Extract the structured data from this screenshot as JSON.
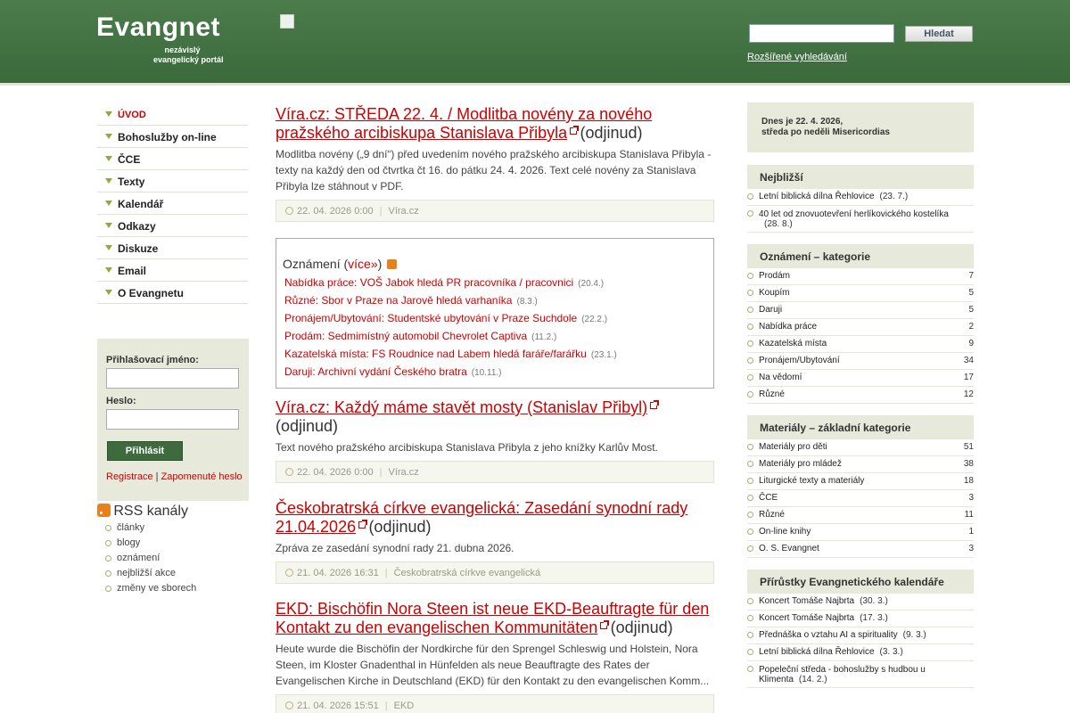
{
  "header": {
    "logo_title": "Evangnet",
    "logo_sub1": "nezávislý",
    "logo_sub2": "evangelický portál",
    "search_button": "Hledat",
    "advanced_search": "Rozšířené vyhledávání"
  },
  "nav": [
    {
      "label": "ÚVOD",
      "active": true
    },
    {
      "label": "Bohoslužby on-line"
    },
    {
      "label": "ČCE"
    },
    {
      "label": "Texty"
    },
    {
      "label": "Kalendář"
    },
    {
      "label": "Odkazy"
    },
    {
      "label": "Diskuze"
    },
    {
      "label": "Email"
    },
    {
      "label": "O Evangnetu"
    }
  ],
  "login": {
    "username_label": "Přihlašovací jméno:",
    "password_label": "Heslo:",
    "button": "Přihlásit",
    "register": "Registrace",
    "separator": "|",
    "forgot": "Zapomenuté heslo"
  },
  "rss": {
    "title": "RSS kanály",
    "items": [
      "články",
      "blogy",
      "oznámení",
      "nejbližší akce",
      "změny ve sborech"
    ]
  },
  "articles": [
    {
      "title": "Víra.cz: STŘEDA 22. 4. / Modlitba novény za nového pražského arcibiskupa Stanislava Přibyla",
      "odjinud": "(odjinud)",
      "perex": "Modlitba novény („9 dní“) před uvedením nového pražského arcibiskupa Stanislava Přibyla - texty na každý den od čtvrtka čt 16. do pátku 24. 4. 2026. Text celé novény za Stanislava Přibyla lze stáhnout v PDF.",
      "date": "22. 04. 2026 0:00",
      "source": "Víra.cz"
    },
    {
      "title": "Víra.cz: Každý máme stavět mosty (Stanislav Přibyl)",
      "odjinud": "(odjinud)",
      "perex": "Text nového pražského arcibiskupa Stanislava Přibyla z jeho knížky Karlův Most.",
      "date": "22. 04. 2026 0:00",
      "source": "Víra.cz"
    },
    {
      "title": "Českobratrská církve evangelická: Zasedání synodní rady 21.04.2026",
      "odjinud": "(odjinud)",
      "perex": "Zpráva ze zasedání synodní rady 21. dubna 2026.",
      "date": "21. 04. 2026 16:31",
      "source": "Českobratrská církve evangelická"
    },
    {
      "title": "EKD: Bischöfin Nora Steen ist neue EKD-Beauftragte für den Kontakt zu den evangelischen Kommunitäten",
      "odjinud": "(odjinud)",
      "perex": "Heute wurde die Bischöfin der Nordkirche für den Sprengel Schleswig und Holstein, Nora Steen, im Kloster Gnadenthal in Hünfelden als neue Beauftragte des Rates der Evangelischen Kirche in Deutschland (EKD) für den Kontakt zu den evangelischen Komm...",
      "date": "21. 04. 2026 15:51",
      "source": "EKD"
    }
  ],
  "notices": {
    "head_prefix": "Oznámení (",
    "head_link": "více»",
    "head_suffix": ")",
    "items": [
      {
        "text": "Nabídka práce: VOŠ Jabok hledá PR pracovníka / pracovnici",
        "date": "(20.4.)"
      },
      {
        "text": "Různé: Sbor v Praze na Jarově hledá varhaníka",
        "date": "(8.3.)"
      },
      {
        "text": "Pronájem/Ubytování: Studentské ubytování v Praze Suchdole",
        "date": "(22.2.)"
      },
      {
        "text": "Prodám: Sedmimístný automobil Chevrolet Captiva",
        "date": "(11.2.)"
      },
      {
        "text": "Kazatelská místa: FS Roudnice nad Labem hledá faráře/farářku",
        "date": "(23.1.)"
      },
      {
        "text": "Daruji: Archivní vydání Českého bratra",
        "date": "(10.11.)"
      }
    ]
  },
  "today": {
    "link": "Dnes",
    "text1": " je 22. 4. 2026,",
    "text2": "středa po neděli Misericordias"
  },
  "nearest": {
    "title": "Nejbližší",
    "items": [
      {
        "text": "Letní biblická dílna Řehlovice",
        "date": "(23. 7.)"
      },
      {
        "text": "40 let od znovuotevření herlíkovického kostelíka",
        "date": "(28. 8.)"
      }
    ]
  },
  "notice_categories": {
    "title": "Oznámení – kategorie",
    "items": [
      {
        "text": "Prodám",
        "count": "7"
      },
      {
        "text": "Koupím",
        "count": "5"
      },
      {
        "text": "Daruji",
        "count": "5"
      },
      {
        "text": "Nabídka práce",
        "count": "2"
      },
      {
        "text": "Kazatelská místa",
        "count": "9"
      },
      {
        "text": "Pronájem/Ubytování",
        "count": "34"
      },
      {
        "text": "Na vědomí",
        "count": "17"
      },
      {
        "text": "Různé",
        "count": "12"
      }
    ]
  },
  "materials": {
    "title": "Materiály – základní kategorie",
    "items": [
      {
        "text": "Materiály pro děti",
        "count": "51"
      },
      {
        "text": "Materiály pro mládež",
        "count": "38"
      },
      {
        "text": "Liturgické texty a materiály",
        "count": "18"
      },
      {
        "text": "ČCE",
        "count": "3"
      },
      {
        "text": "Různé",
        "count": "11"
      },
      {
        "text": "On-line knihy",
        "count": "1"
      },
      {
        "text": "O. S. Evangnet",
        "count": "3"
      }
    ]
  },
  "calendar": {
    "title": "Přírůstky Evangnetického kalendáře",
    "items": [
      {
        "text": "Koncert Tomáše Najbrta",
        "date": "(30. 3.)"
      },
      {
        "text": "Koncert Tomáše Najbrta",
        "date": "(17. 3.)"
      },
      {
        "text": "Přednáška o vztahu AI a spirituality",
        "date": "(9. 3.)"
      },
      {
        "text": "Letní biblická dílna Řehlovice",
        "date": "(3. 3.)"
      },
      {
        "text": "Popeleční středa - bohoslužby s hudbou u Klimenta",
        "date": "(14. 2.)"
      }
    ]
  }
}
